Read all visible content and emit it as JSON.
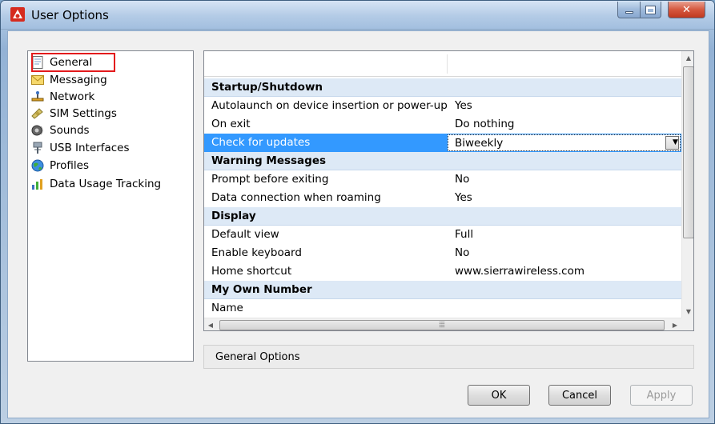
{
  "window": {
    "title": "User Options",
    "icon": "sierra-app-icon",
    "controls": [
      "minimize-icon",
      "maximize-icon",
      "close-icon"
    ]
  },
  "sidebar": {
    "items": [
      {
        "label": "General",
        "icon": "page-icon",
        "selected": true
      },
      {
        "label": "Messaging",
        "icon": "envelope-icon"
      },
      {
        "label": "Network",
        "icon": "network-icon"
      },
      {
        "label": "SIM Settings",
        "icon": "sim-card-icon"
      },
      {
        "label": "Sounds",
        "icon": "speaker-icon"
      },
      {
        "label": "USB Interfaces",
        "icon": "usb-icon"
      },
      {
        "label": "Profiles",
        "icon": "globe-icon"
      },
      {
        "label": "Data Usage Tracking",
        "icon": "chart-icon"
      }
    ],
    "highlight_color": "#e31a1c"
  },
  "properties": {
    "sections": [
      {
        "name": "Startup/Shutdown",
        "rows": [
          {
            "key": "Autolaunch on device insertion or power-up",
            "value": "Yes"
          },
          {
            "key": "On exit",
            "value": "Do nothing"
          },
          {
            "key": "Check for updates",
            "value": "Biweekly",
            "selected": true,
            "dropdown": true
          }
        ]
      },
      {
        "name": "Warning Messages",
        "rows": [
          {
            "key": "Prompt before exiting",
            "value": "No"
          },
          {
            "key": "Data connection when roaming",
            "value": "Yes"
          }
        ]
      },
      {
        "name": "Display",
        "rows": [
          {
            "key": "Default view",
            "value": "Full"
          },
          {
            "key": "Enable keyboard",
            "value": "No"
          },
          {
            "key": "Home shortcut",
            "value": "www.sierrawireless.com"
          }
        ]
      },
      {
        "name": "My Own Number",
        "rows": [
          {
            "key": "Name",
            "value": ""
          }
        ]
      }
    ],
    "selection_color": "#3399ff",
    "category_color": "#dde9f6"
  },
  "description": {
    "text": "General Options"
  },
  "buttons": {
    "ok": "OK",
    "cancel": "Cancel",
    "apply": "Apply"
  }
}
